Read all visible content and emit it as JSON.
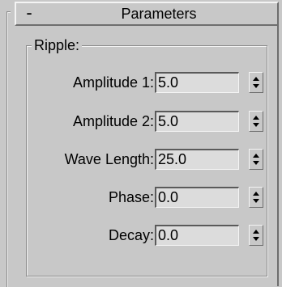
{
  "rollout": {
    "collapse_symbol": "-",
    "title": "Parameters"
  },
  "group": {
    "legend": "Ripple:"
  },
  "params": [
    {
      "label": "Amplitude 1:",
      "value": "5.0"
    },
    {
      "label": "Amplitude 2:",
      "value": "5.0"
    },
    {
      "label": "Wave Length:",
      "value": "25.0"
    },
    {
      "label": "Phase:",
      "value": "0.0"
    },
    {
      "label": "Decay:",
      "value": "0.0"
    }
  ],
  "colors": {
    "panel_bg": "#c8c8c8",
    "field_bg": "#dcdcdc"
  }
}
